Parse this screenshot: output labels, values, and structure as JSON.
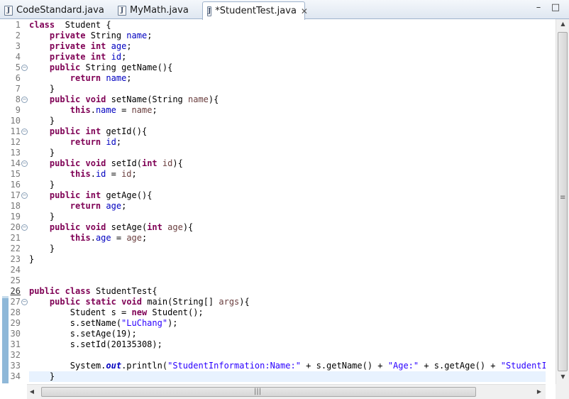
{
  "tabs": [
    {
      "label": "CodeStandard.java",
      "icon": "java-file-icon",
      "active": false
    },
    {
      "label": "MyMath.java",
      "icon": "java-file-icon",
      "active": false
    },
    {
      "label": "*StudentTest.java",
      "icon": "java-file-icon",
      "active": true
    }
  ],
  "window_controls": {
    "minimize": "–",
    "maximize": "□"
  },
  "line_numbers": [
    "1",
    "2",
    "3",
    "4",
    "5",
    "6",
    "7",
    "8",
    "9",
    "10",
    "11",
    "12",
    "13",
    "14",
    "15",
    "16",
    "17",
    "18",
    "19",
    "20",
    "21",
    "22",
    "23",
    "24",
    "25",
    "26",
    "27",
    "28",
    "29",
    "30",
    "31",
    "32",
    "33",
    "34"
  ],
  "fold_lines": [
    5,
    8,
    11,
    14,
    17,
    20,
    27
  ],
  "code_lines": [
    [
      [
        "kw",
        "class"
      ],
      [
        "",
        "  Student {"
      ]
    ],
    [
      [
        "",
        "    "
      ],
      [
        "kw",
        "private"
      ],
      [
        "",
        " String "
      ],
      [
        "fld",
        "name"
      ],
      [
        "",
        ";"
      ]
    ],
    [
      [
        "",
        "    "
      ],
      [
        "kw",
        "private"
      ],
      [
        "",
        " "
      ],
      [
        "kw",
        "int"
      ],
      [
        "",
        " "
      ],
      [
        "fld",
        "age"
      ],
      [
        "",
        ";"
      ]
    ],
    [
      [
        "",
        "    "
      ],
      [
        "kw",
        "private"
      ],
      [
        "",
        " "
      ],
      [
        "kw",
        "int"
      ],
      [
        "",
        " "
      ],
      [
        "fld",
        "id"
      ],
      [
        "",
        ";"
      ]
    ],
    [
      [
        "",
        "    "
      ],
      [
        "kw",
        "public"
      ],
      [
        "",
        " String getName(){"
      ]
    ],
    [
      [
        "",
        "        "
      ],
      [
        "kw",
        "return"
      ],
      [
        "",
        " "
      ],
      [
        "fld",
        "name"
      ],
      [
        "",
        ";"
      ]
    ],
    [
      [
        "",
        "    }"
      ]
    ],
    [
      [
        "",
        "    "
      ],
      [
        "kw",
        "public"
      ],
      [
        "",
        " "
      ],
      [
        "kw",
        "void"
      ],
      [
        "",
        " setName(String "
      ],
      [
        "par",
        "name"
      ],
      [
        "",
        "){"
      ]
    ],
    [
      [
        "",
        "        "
      ],
      [
        "kw",
        "this"
      ],
      [
        "",
        "."
      ],
      [
        "fld",
        "name"
      ],
      [
        "",
        " = "
      ],
      [
        "par",
        "name"
      ],
      [
        "",
        ";"
      ]
    ],
    [
      [
        "",
        "    }"
      ]
    ],
    [
      [
        "",
        "    "
      ],
      [
        "kw",
        "public"
      ],
      [
        "",
        " "
      ],
      [
        "kw",
        "int"
      ],
      [
        "",
        " getId(){"
      ]
    ],
    [
      [
        "",
        "        "
      ],
      [
        "kw",
        "return"
      ],
      [
        "",
        " "
      ],
      [
        "fld",
        "id"
      ],
      [
        "",
        ";"
      ]
    ],
    [
      [
        "",
        "    }"
      ]
    ],
    [
      [
        "",
        "    "
      ],
      [
        "kw",
        "public"
      ],
      [
        "",
        " "
      ],
      [
        "kw",
        "void"
      ],
      [
        "",
        " setId("
      ],
      [
        "kw",
        "int"
      ],
      [
        "",
        " "
      ],
      [
        "par",
        "id"
      ],
      [
        "",
        "){"
      ]
    ],
    [
      [
        "",
        "        "
      ],
      [
        "kw",
        "this"
      ],
      [
        "",
        "."
      ],
      [
        "fld",
        "id"
      ],
      [
        "",
        " = "
      ],
      [
        "par",
        "id"
      ],
      [
        "",
        ";"
      ]
    ],
    [
      [
        "",
        "    }"
      ]
    ],
    [
      [
        "",
        "    "
      ],
      [
        "kw",
        "public"
      ],
      [
        "",
        " "
      ],
      [
        "kw",
        "int"
      ],
      [
        "",
        " getAge(){"
      ]
    ],
    [
      [
        "",
        "        "
      ],
      [
        "kw",
        "return"
      ],
      [
        "",
        " "
      ],
      [
        "fld",
        "age"
      ],
      [
        "",
        ";"
      ]
    ],
    [
      [
        "",
        "    }"
      ]
    ],
    [
      [
        "",
        "    "
      ],
      [
        "kw",
        "public"
      ],
      [
        "",
        " "
      ],
      [
        "kw",
        "void"
      ],
      [
        "",
        " setAge("
      ],
      [
        "kw",
        "int"
      ],
      [
        "",
        " "
      ],
      [
        "par",
        "age"
      ],
      [
        "",
        "){"
      ]
    ],
    [
      [
        "",
        "        "
      ],
      [
        "kw",
        "this"
      ],
      [
        "",
        "."
      ],
      [
        "fld",
        "age"
      ],
      [
        "",
        " = "
      ],
      [
        "par",
        "age"
      ],
      [
        "",
        ";"
      ]
    ],
    [
      [
        "",
        "    }"
      ]
    ],
    [
      [
        "",
        "}"
      ]
    ],
    [
      [
        "",
        ""
      ]
    ],
    [
      [
        "",
        ""
      ]
    ],
    [
      [
        "kw",
        "public"
      ],
      [
        "",
        " "
      ],
      [
        "kw",
        "class"
      ],
      [
        "",
        " StudentTest{"
      ]
    ],
    [
      [
        "",
        "    "
      ],
      [
        "kw",
        "public"
      ],
      [
        "",
        " "
      ],
      [
        "kw",
        "static"
      ],
      [
        "",
        " "
      ],
      [
        "kw",
        "void"
      ],
      [
        "",
        " main(String[] "
      ],
      [
        "par",
        "args"
      ],
      [
        "",
        "){"
      ]
    ],
    [
      [
        "",
        "        Student s = "
      ],
      [
        "kw",
        "new"
      ],
      [
        "",
        " Student();"
      ]
    ],
    [
      [
        "",
        "        s.setName("
      ],
      [
        "str",
        "\"LuChang\""
      ],
      [
        "",
        ");"
      ]
    ],
    [
      [
        "",
        "        s.setAge(19);"
      ]
    ],
    [
      [
        "",
        "        s.setId(20135308);"
      ]
    ],
    [
      [
        "",
        ""
      ]
    ],
    [
      [
        "",
        "        System."
      ],
      [
        "sta",
        "out"
      ],
      [
        "",
        ".println("
      ],
      [
        "str",
        "\"StudentInformation:Name:\""
      ],
      [
        "",
        " + s.getName() + "
      ],
      [
        "str",
        "\"Age:\""
      ],
      [
        "",
        " + s.getAge() + "
      ],
      [
        "str",
        "\"StudentID\""
      ]
    ],
    [
      [
        "",
        "    }"
      ]
    ]
  ],
  "current_line": 34,
  "colors": {
    "keyword": "#7f0055",
    "field": "#0000c0",
    "string": "#2a00ff",
    "parameter": "#6a3e3e",
    "current_line_bg": "#e8f2fe"
  }
}
